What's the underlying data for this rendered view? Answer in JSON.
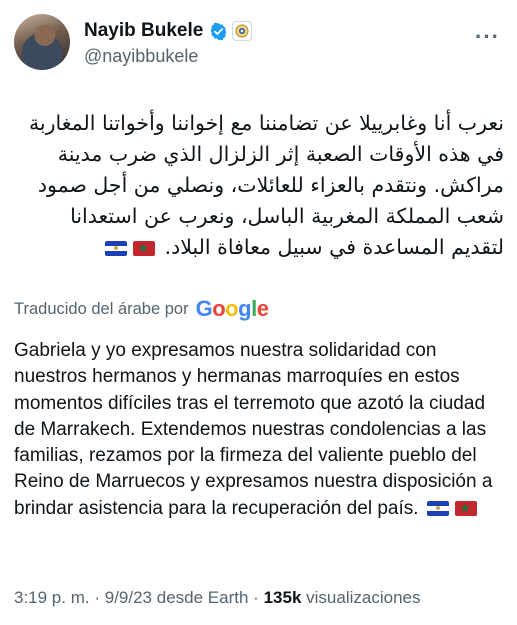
{
  "author": {
    "display_name": "Nayib Bukele",
    "handle": "@nayibbukele",
    "verified_icon": "verified-badge-icon",
    "affiliation_icon": "government-seal-icon"
  },
  "header": {
    "more_glyph": "···"
  },
  "tweet": {
    "arabic_text": "نعرب أنا وغابرييلا عن تضامننا مع إخواننا وأخواتنا المغاربة في هذه الأوقات الصعبة إثر الزلزال الذي ضرب مدينة مراكش. ونتقدم بالعزاء للعائلات، ونصلي من أجل صمود شعب المملكة المغربية الباسل، ونعرب عن استعدانا لتقديم المساعدة في سبيل معافاة البلاد.",
    "translation_label": "Traducido del árabe por",
    "translation_provider": "Google",
    "spanish_text": "Gabriela y yo expresamos nuestra solidaridad con nuestros hermanos y hermanas marroquíes en estos momentos difíciles tras el terremoto que azotó la ciudad de Marrakech. Extendemos nuestras condolencias a las familias, rezamos por la firmeza del valiente pueblo del Reino de Marruecos y expresamos nuestra disposición a brindar asistencia para la recuperación del país.",
    "flags": [
      "flag-el-salvador",
      "flag-morocco"
    ]
  },
  "meta": {
    "time": "3:19 p. m.",
    "separator": "·",
    "date": "9/9/23",
    "source": "desde Earth",
    "views_count": "135k",
    "views_label": "visualizaciones"
  },
  "colors": {
    "text_primary": "#0f1419",
    "text_secondary": "#536471",
    "verified_blue": "#1d9bf0",
    "google_blue": "#4285F4",
    "google_red": "#EA4335",
    "google_yellow": "#FBBC05",
    "google_green": "#34A853"
  }
}
